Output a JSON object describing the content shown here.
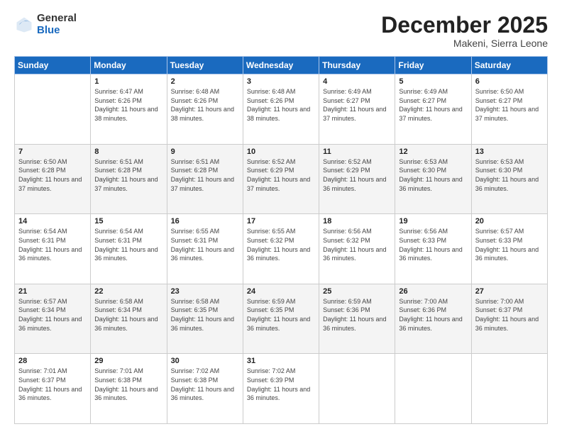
{
  "logo": {
    "general": "General",
    "blue": "Blue"
  },
  "header": {
    "title": "December 2025",
    "location": "Makeni, Sierra Leone"
  },
  "days_of_week": [
    "Sunday",
    "Monday",
    "Tuesday",
    "Wednesday",
    "Thursday",
    "Friday",
    "Saturday"
  ],
  "weeks": [
    [
      {
        "day": "",
        "sunrise": "",
        "sunset": "",
        "daylight": ""
      },
      {
        "day": "1",
        "sunrise": "6:47 AM",
        "sunset": "6:26 PM",
        "daylight": "11 hours and 38 minutes."
      },
      {
        "day": "2",
        "sunrise": "6:48 AM",
        "sunset": "6:26 PM",
        "daylight": "11 hours and 38 minutes."
      },
      {
        "day": "3",
        "sunrise": "6:48 AM",
        "sunset": "6:26 PM",
        "daylight": "11 hours and 38 minutes."
      },
      {
        "day": "4",
        "sunrise": "6:49 AM",
        "sunset": "6:27 PM",
        "daylight": "11 hours and 37 minutes."
      },
      {
        "day": "5",
        "sunrise": "6:49 AM",
        "sunset": "6:27 PM",
        "daylight": "11 hours and 37 minutes."
      },
      {
        "day": "6",
        "sunrise": "6:50 AM",
        "sunset": "6:27 PM",
        "daylight": "11 hours and 37 minutes."
      }
    ],
    [
      {
        "day": "7",
        "sunrise": "6:50 AM",
        "sunset": "6:28 PM",
        "daylight": "11 hours and 37 minutes."
      },
      {
        "day": "8",
        "sunrise": "6:51 AM",
        "sunset": "6:28 PM",
        "daylight": "11 hours and 37 minutes."
      },
      {
        "day": "9",
        "sunrise": "6:51 AM",
        "sunset": "6:28 PM",
        "daylight": "11 hours and 37 minutes."
      },
      {
        "day": "10",
        "sunrise": "6:52 AM",
        "sunset": "6:29 PM",
        "daylight": "11 hours and 37 minutes."
      },
      {
        "day": "11",
        "sunrise": "6:52 AM",
        "sunset": "6:29 PM",
        "daylight": "11 hours and 36 minutes."
      },
      {
        "day": "12",
        "sunrise": "6:53 AM",
        "sunset": "6:30 PM",
        "daylight": "11 hours and 36 minutes."
      },
      {
        "day": "13",
        "sunrise": "6:53 AM",
        "sunset": "6:30 PM",
        "daylight": "11 hours and 36 minutes."
      }
    ],
    [
      {
        "day": "14",
        "sunrise": "6:54 AM",
        "sunset": "6:31 PM",
        "daylight": "11 hours and 36 minutes."
      },
      {
        "day": "15",
        "sunrise": "6:54 AM",
        "sunset": "6:31 PM",
        "daylight": "11 hours and 36 minutes."
      },
      {
        "day": "16",
        "sunrise": "6:55 AM",
        "sunset": "6:31 PM",
        "daylight": "11 hours and 36 minutes."
      },
      {
        "day": "17",
        "sunrise": "6:55 AM",
        "sunset": "6:32 PM",
        "daylight": "11 hours and 36 minutes."
      },
      {
        "day": "18",
        "sunrise": "6:56 AM",
        "sunset": "6:32 PM",
        "daylight": "11 hours and 36 minutes."
      },
      {
        "day": "19",
        "sunrise": "6:56 AM",
        "sunset": "6:33 PM",
        "daylight": "11 hours and 36 minutes."
      },
      {
        "day": "20",
        "sunrise": "6:57 AM",
        "sunset": "6:33 PM",
        "daylight": "11 hours and 36 minutes."
      }
    ],
    [
      {
        "day": "21",
        "sunrise": "6:57 AM",
        "sunset": "6:34 PM",
        "daylight": "11 hours and 36 minutes."
      },
      {
        "day": "22",
        "sunrise": "6:58 AM",
        "sunset": "6:34 PM",
        "daylight": "11 hours and 36 minutes."
      },
      {
        "day": "23",
        "sunrise": "6:58 AM",
        "sunset": "6:35 PM",
        "daylight": "11 hours and 36 minutes."
      },
      {
        "day": "24",
        "sunrise": "6:59 AM",
        "sunset": "6:35 PM",
        "daylight": "11 hours and 36 minutes."
      },
      {
        "day": "25",
        "sunrise": "6:59 AM",
        "sunset": "6:36 PM",
        "daylight": "11 hours and 36 minutes."
      },
      {
        "day": "26",
        "sunrise": "7:00 AM",
        "sunset": "6:36 PM",
        "daylight": "11 hours and 36 minutes."
      },
      {
        "day": "27",
        "sunrise": "7:00 AM",
        "sunset": "6:37 PM",
        "daylight": "11 hours and 36 minutes."
      }
    ],
    [
      {
        "day": "28",
        "sunrise": "7:01 AM",
        "sunset": "6:37 PM",
        "daylight": "11 hours and 36 minutes."
      },
      {
        "day": "29",
        "sunrise": "7:01 AM",
        "sunset": "6:38 PM",
        "daylight": "11 hours and 36 minutes."
      },
      {
        "day": "30",
        "sunrise": "7:02 AM",
        "sunset": "6:38 PM",
        "daylight": "11 hours and 36 minutes."
      },
      {
        "day": "31",
        "sunrise": "7:02 AM",
        "sunset": "6:39 PM",
        "daylight": "11 hours and 36 minutes."
      },
      {
        "day": "",
        "sunrise": "",
        "sunset": "",
        "daylight": ""
      },
      {
        "day": "",
        "sunrise": "",
        "sunset": "",
        "daylight": ""
      },
      {
        "day": "",
        "sunrise": "",
        "sunset": "",
        "daylight": ""
      }
    ]
  ]
}
